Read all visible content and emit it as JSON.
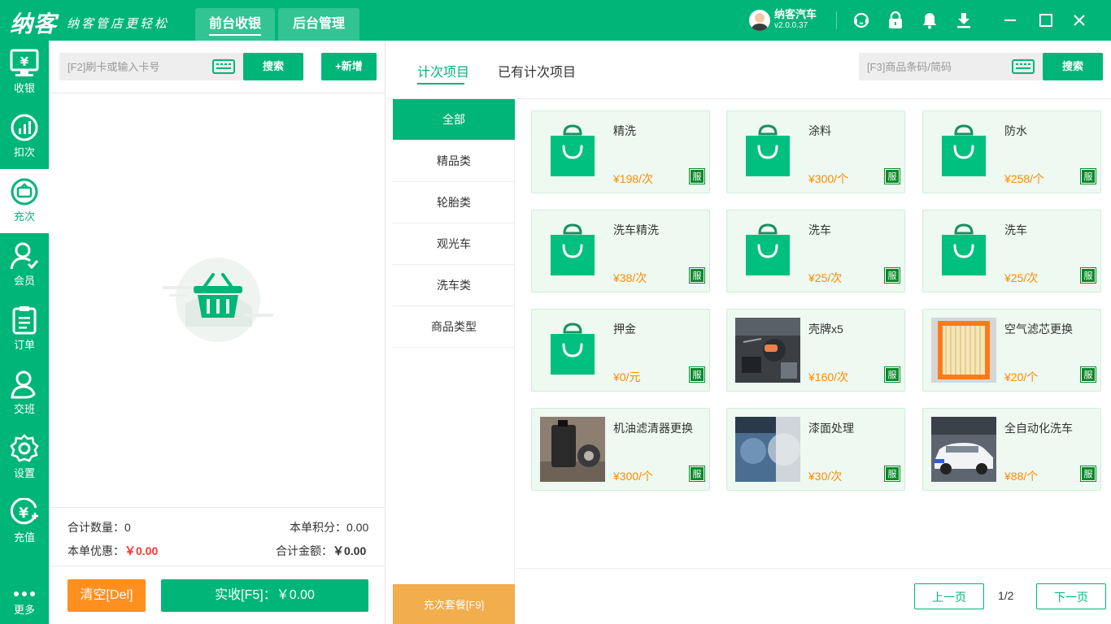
{
  "app": {
    "logo_main": "纳客",
    "logo_slogan": "纳客管店更轻松",
    "nav_tabs": [
      "前台收银",
      "后台管理"
    ],
    "user_name": "纳客汽车",
    "version": "v2.0.0.37"
  },
  "sidebar": {
    "items": [
      "收银",
      "扣次",
      "充次",
      "会员",
      "订单",
      "交班",
      "设置",
      "充值"
    ],
    "more": "更多"
  },
  "cart": {
    "card_placeholder": "[F2]刷卡或输入卡号",
    "search_label": "搜索",
    "add_label": "+新增",
    "total_qty_label": "合计数量：",
    "total_qty": "0",
    "points_label": "本单积分：",
    "points": "0.00",
    "discount_label": "本单优惠：",
    "discount": "￥0.00",
    "total_amount_label": "合计金额：",
    "total_amount": "￥0.00",
    "clear_label": "清空[Del]",
    "pay_label": "实收[F5]：￥0.00"
  },
  "main": {
    "tabs": [
      "计次项目",
      "已有计次项目"
    ],
    "goods_placeholder": "[F3]商品条码/简码",
    "search_label": "搜索",
    "categories": [
      "全部",
      "精品类",
      "轮胎类",
      "观光车",
      "洗车类",
      "商品类型"
    ],
    "package_label": "充次套餐[F9]",
    "products": [
      {
        "name": "精洗",
        "price": "¥198/次",
        "badge": "服",
        "img": "bag"
      },
      {
        "name": "涂料",
        "price": "¥300/个",
        "badge": "服",
        "img": "bag"
      },
      {
        "name": "防水",
        "price": "¥258/个",
        "badge": "服",
        "img": "bag"
      },
      {
        "name": "洗车精洗",
        "price": "¥38/次",
        "badge": "服",
        "img": "bag"
      },
      {
        "name": "洗车",
        "price": "¥25/次",
        "badge": "服",
        "img": "bag"
      },
      {
        "name": "洗车",
        "price": "¥25/次",
        "badge": "服",
        "img": "bag"
      },
      {
        "name": "押金",
        "price": "¥0/元",
        "badge": "服",
        "img": "bag"
      },
      {
        "name": "壳牌x5",
        "price": "¥160/次",
        "badge": "服",
        "img": "engine"
      },
      {
        "name": "空气滤芯更换",
        "price": "¥20/个",
        "badge": "服",
        "img": "filter"
      },
      {
        "name": "机油滤清器更换",
        "price": "¥300/个",
        "badge": "服",
        "img": "oil"
      },
      {
        "name": "漆面处理",
        "price": "¥30/次",
        "badge": "服",
        "img": "paint"
      },
      {
        "name": "全自动化洗车",
        "price": "¥88/个",
        "badge": "服",
        "img": "car"
      }
    ],
    "prev_label": "上一页",
    "page": "1/2",
    "next_label": "下一页"
  },
  "colors": {
    "brand": "#00b578",
    "price": "#ff8a00",
    "clear_button": "#ff8f1f",
    "package_button": "#f2ad4c",
    "badge": "#0a8a2a"
  }
}
